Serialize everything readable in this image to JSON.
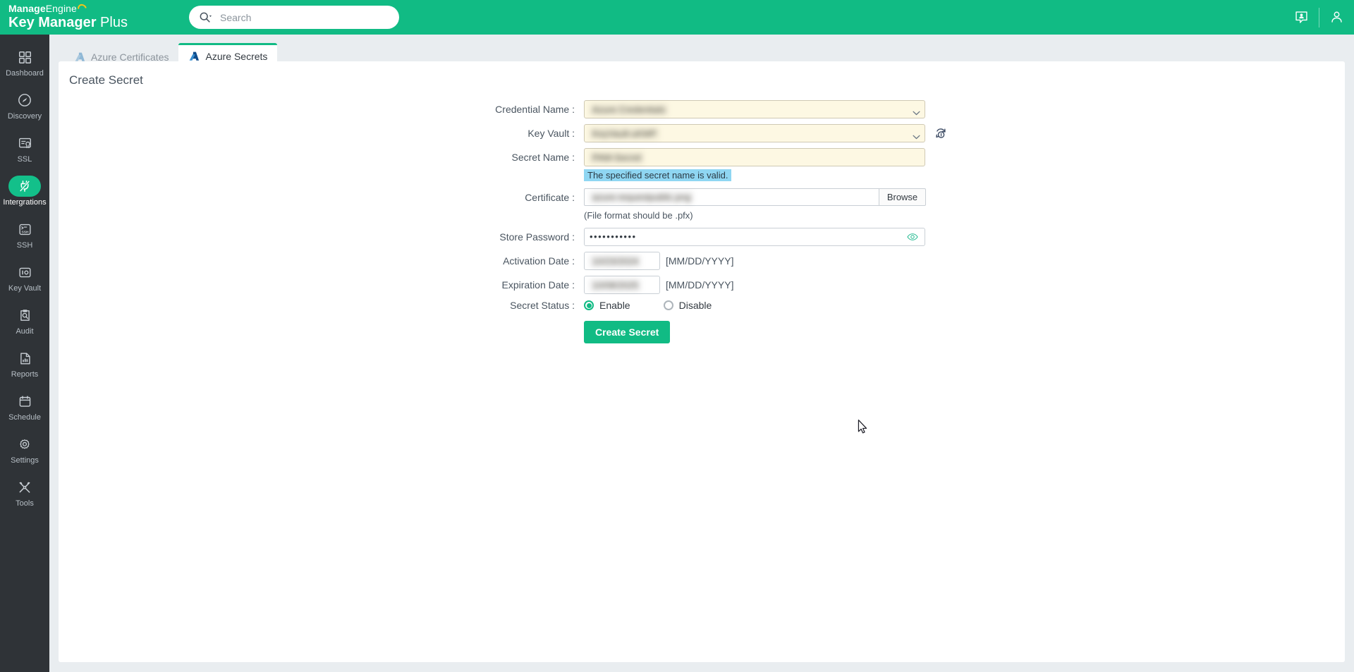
{
  "header": {
    "brand_top_strong": "Manage",
    "brand_top_light": "Engine",
    "brand_bottom_strong": "Key Manager",
    "brand_bottom_light": " Plus",
    "search_placeholder": "Search",
    "search_value": "",
    "search_icon": "search-icon",
    "notification_icon": "notification-user-icon",
    "profile_icon": "user-profile-icon",
    "accent_color": "#11bb84"
  },
  "sidebar": {
    "items": [
      {
        "label": "Dashboard",
        "icon": "grid-icon",
        "active": false
      },
      {
        "label": "Discovery",
        "icon": "compass-icon",
        "active": false
      },
      {
        "label": "SSL",
        "icon": "certificate-icon",
        "active": false
      },
      {
        "label": "Intergrations",
        "icon": "plug-icon",
        "active": true
      },
      {
        "label": "SSH",
        "icon": "terminal-icon",
        "active": false
      },
      {
        "label": "Key Vault",
        "icon": "vault-icon",
        "active": false
      },
      {
        "label": "Audit",
        "icon": "audit-search-icon",
        "active": false
      },
      {
        "label": "Reports",
        "icon": "report-chart-icon",
        "active": false
      },
      {
        "label": "Schedule",
        "icon": "calendar-icon",
        "active": false
      },
      {
        "label": "Settings",
        "icon": "gear-icon",
        "active": false
      },
      {
        "label": "Tools",
        "icon": "tools-icon",
        "active": false
      }
    ],
    "active_color": "#13c08a",
    "background": "#2f3337"
  },
  "tabs": [
    {
      "label": "Azure Certificates",
      "icon": "azure-a-icon",
      "active": false
    },
    {
      "label": "Azure Secrets",
      "icon": "azure-a-icon",
      "active": true
    }
  ],
  "page": {
    "title": "Create Secret"
  },
  "form": {
    "credential_name": {
      "label": "Credential Name :",
      "value": "Azure Credentials",
      "redacted": true,
      "chevron_icon": "chevron-down-icon"
    },
    "key_vault": {
      "label": "Key Vault :",
      "value": "KeyVault-uKMP",
      "redacted": true,
      "chevron_icon": "chevron-down-icon",
      "refresh_icon": "refresh-sync-icon"
    },
    "secret_name": {
      "label": "Secret Name :",
      "value": "PAM-Secret",
      "redacted": true,
      "validation_message": "The specified secret name is valid.",
      "validation_bg": "#8fd6f2"
    },
    "certificate": {
      "label": "Certificate :",
      "value": "azure-requestpublic.png",
      "redacted": true,
      "browse_label": "Browse",
      "helper_text": "(File format should be .pfx)"
    },
    "store_password": {
      "label": "Store Password :",
      "value": "•••••••••••",
      "eye_icon": "eye-icon"
    },
    "activation_date": {
      "label": "Activation Date :",
      "value": "10/23/2024",
      "redacted": true,
      "format_hint": "[MM/DD/YYYY]"
    },
    "expiration_date": {
      "label": "Expiration Date :",
      "value": "10/08/2025",
      "redacted": true,
      "format_hint": "[MM/DD/YYYY]"
    },
    "secret_status": {
      "label": "Secret Status :",
      "options": [
        {
          "label": "Enable",
          "selected": true
        },
        {
          "label": "Disable",
          "selected": false
        }
      ]
    },
    "submit_label": "Create Secret"
  }
}
